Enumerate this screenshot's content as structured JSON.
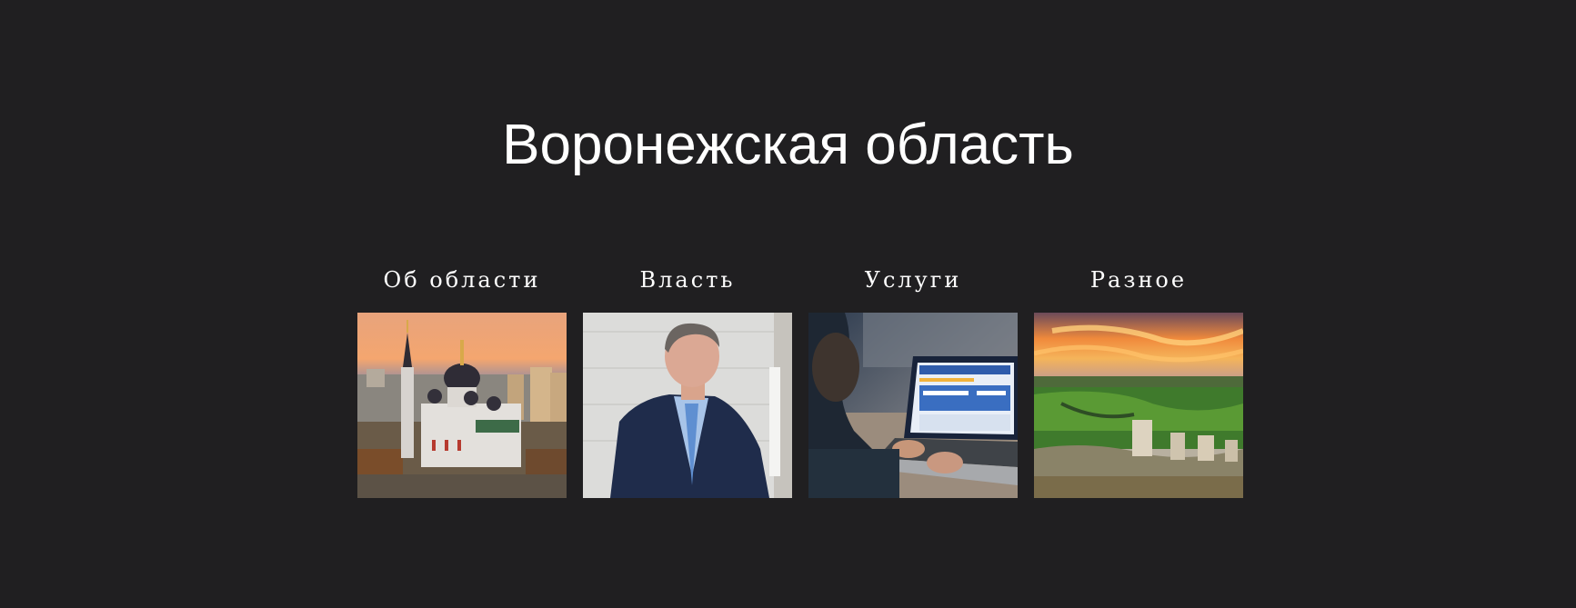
{
  "page": {
    "title": "Воронежская область"
  },
  "cards": [
    {
      "label": "Об области",
      "image": "cathedral-photo"
    },
    {
      "label": "Власть",
      "image": "governor-photo"
    },
    {
      "label": "Услуги",
      "image": "laptop-services-photo"
    },
    {
      "label": "Разное",
      "image": "landscape-photo"
    }
  ],
  "colors": {
    "background": "#201f21",
    "text": "#ffffff"
  }
}
